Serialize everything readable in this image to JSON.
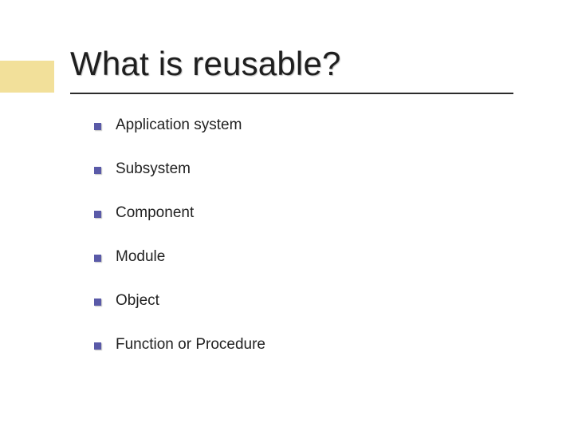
{
  "slide": {
    "title": "What is reusable?",
    "bullets": [
      "Application system",
      "Subsystem",
      "Component",
      "Module",
      "Object",
      "Function or Procedure"
    ]
  },
  "colors": {
    "accent_block": "#f2e09a",
    "bullet_square": "#5a5aa8",
    "underline": "#2b2b2b"
  }
}
